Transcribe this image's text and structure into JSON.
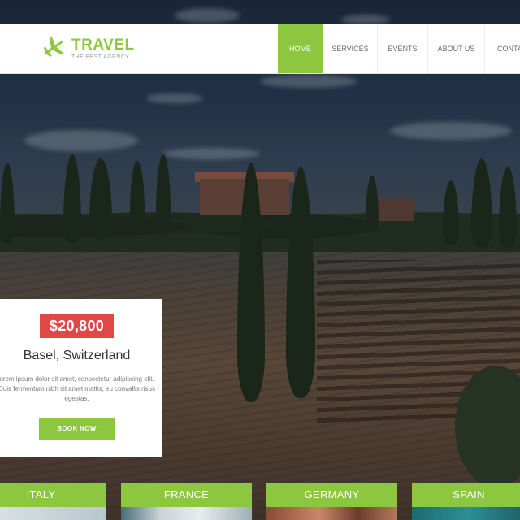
{
  "brand": {
    "title": "TRAVEL",
    "tagline": "THE BEST AGENCY",
    "accent_color": "#8dc63f",
    "icon": "airplane-icon"
  },
  "nav": {
    "items": [
      {
        "label": "HOME",
        "active": true
      },
      {
        "label": "SERVICES",
        "active": false
      },
      {
        "label": "EVENTS",
        "active": false
      },
      {
        "label": "ABOUT US",
        "active": false
      },
      {
        "label": "CONTA",
        "active": false
      }
    ]
  },
  "offer": {
    "price": "$20,800",
    "price_color": "#e04848",
    "city": "Basel, Switzerland",
    "description": "orem ipsum dolor sit amet, consectetur adipiscing elit. Duis fermentum nibh sit amet mattis, eu convallis risus egestas.",
    "button_label": "BOOK NOW"
  },
  "destinations": [
    {
      "label": "ITALY"
    },
    {
      "label": "FRANCE"
    },
    {
      "label": "GERMANY"
    },
    {
      "label": "SPAIN"
    }
  ]
}
